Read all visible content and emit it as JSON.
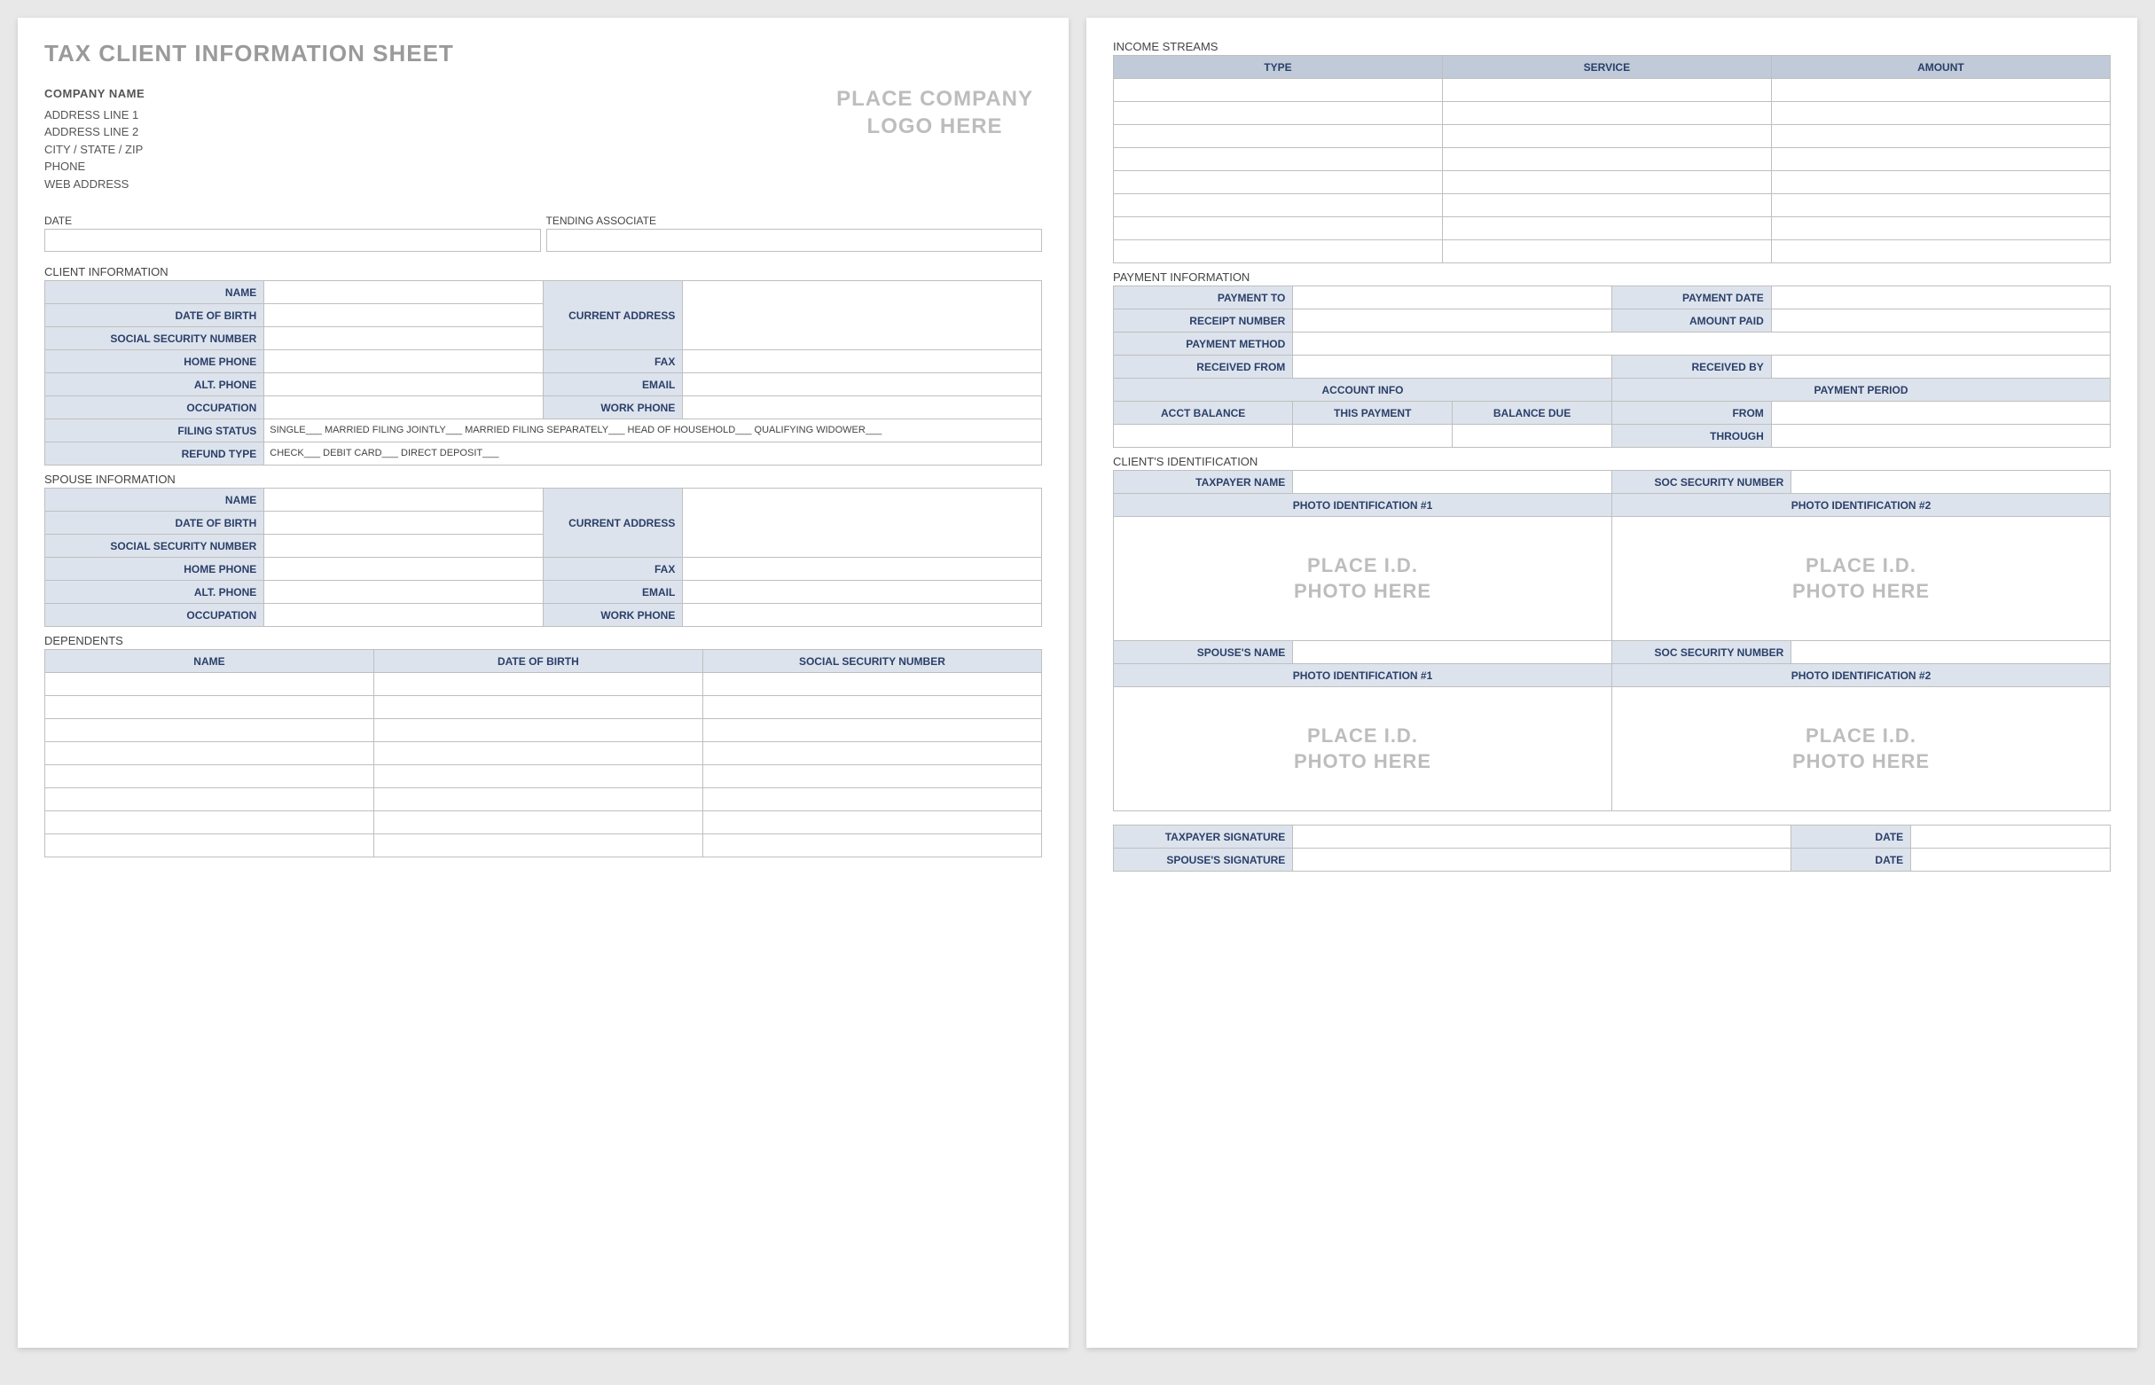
{
  "title": "TAX CLIENT INFORMATION SHEET",
  "company": {
    "name": "COMPANY NAME",
    "addr1": "ADDRESS LINE 1",
    "addr2": "ADDRESS LINE 2",
    "city": "CITY / STATE / ZIP",
    "phone": "PHONE",
    "web": "WEB ADDRESS"
  },
  "logo_placeholder_l1": "PLACE COMPANY",
  "logo_placeholder_l2": "LOGO HERE",
  "labels": {
    "date": "DATE",
    "tending_associate": "TENDING ASSOCIATE",
    "client_info": "CLIENT INFORMATION",
    "spouse_info": "SPOUSE INFORMATION",
    "dependents": "DEPENDENTS",
    "income_streams": "INCOME STREAMS",
    "payment_info": "PAYMENT INFORMATION",
    "client_id": "CLIENT'S IDENTIFICATION",
    "name": "NAME",
    "dob": "DATE OF BIRTH",
    "ssn": "SOCIAL SECURITY NUMBER",
    "home_phone": "HOME PHONE",
    "alt_phone": "ALT. PHONE",
    "occupation": "OCCUPATION",
    "filing_status": "FILING STATUS",
    "refund_type": "REFUND TYPE",
    "current_address": "CURRENT ADDRESS",
    "fax": "FAX",
    "email": "EMAIL",
    "work_phone": "WORK PHONE",
    "type": "TYPE",
    "service": "SERVICE",
    "amount": "AMOUNT",
    "payment_to": "PAYMENT TO",
    "payment_date": "PAYMENT DATE",
    "receipt_number": "RECEIPT NUMBER",
    "amount_paid": "AMOUNT PAID",
    "payment_method": "PAYMENT METHOD",
    "received_from": "RECEIVED FROM",
    "received_by": "RECEIVED BY",
    "account_info": "ACCOUNT INFO",
    "payment_period": "PAYMENT PERIOD",
    "acct_balance": "ACCT BALANCE",
    "this_payment": "THIS PAYMENT",
    "balance_due": "BALANCE DUE",
    "from": "FROM",
    "through": "THROUGH",
    "taxpayer_name": "TAXPAYER NAME",
    "soc_sec_num": "SOC SECURITY NUMBER",
    "photo_id_1": "PHOTO IDENTIFICATION #1",
    "photo_id_2": "PHOTO IDENTIFICATION #2",
    "spouses_name": "SPOUSE'S NAME",
    "taxpayer_sig": "TAXPAYER SIGNATURE",
    "spouses_sig": "SPOUSE'S SIGNATURE",
    "dep_name": "NAME",
    "dep_dob": "DATE OF BIRTH",
    "dep_ssn": "SOCIAL SECURITY NUMBER"
  },
  "filing_status_text": "SINGLE___   MARRIED FILING JOINTLY___   MARRIED FILING SEPARATELY___   HEAD OF HOUSEHOLD___   QUALIFYING WIDOWER___",
  "refund_type_text": "CHECK___   DEBIT CARD___   DIRECT DEPOSIT___",
  "photo_placeholder_l1": "PLACE I.D.",
  "photo_placeholder_l2": "PHOTO HERE"
}
